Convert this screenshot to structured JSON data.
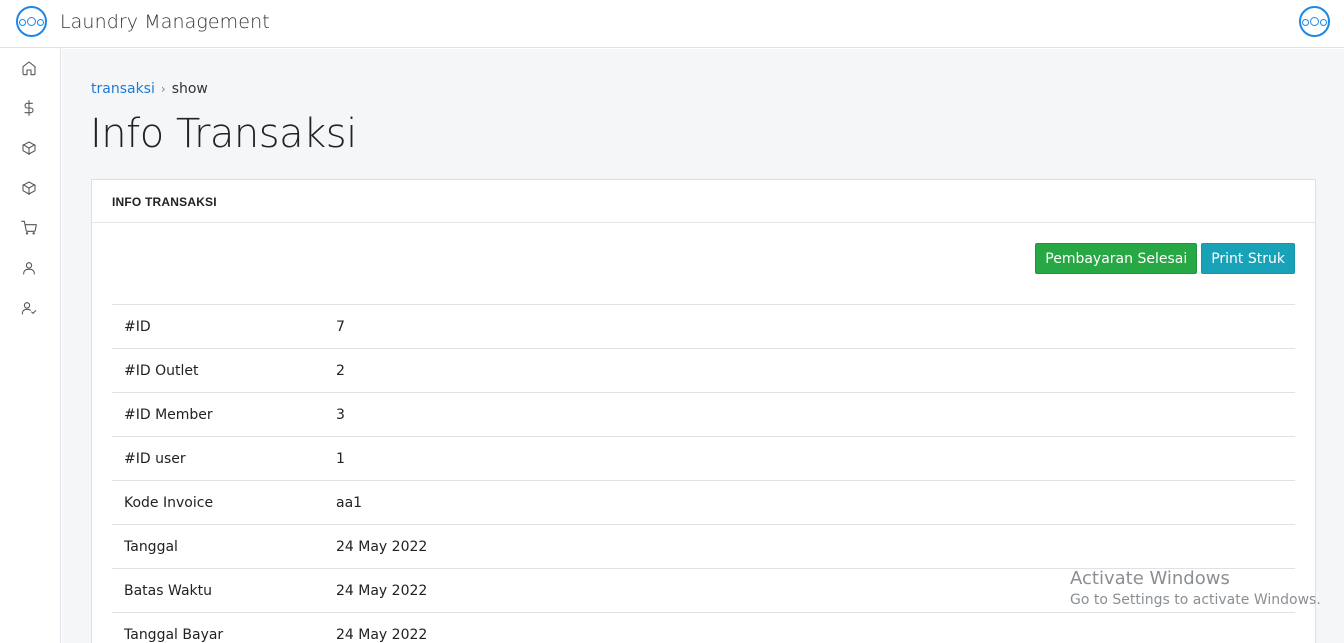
{
  "app": {
    "title": "Laundry Management"
  },
  "sidebar": {
    "items": [
      {
        "icon": "home-icon"
      },
      {
        "icon": "dollar-icon"
      },
      {
        "icon": "box-icon"
      },
      {
        "icon": "box-icon"
      },
      {
        "icon": "cart-icon"
      },
      {
        "icon": "user-icon"
      },
      {
        "icon": "user-check-icon"
      }
    ]
  },
  "breadcrumb": {
    "parent": "transaksi",
    "separator": "›",
    "current": "show"
  },
  "page": {
    "title": "Info Transaksi"
  },
  "card": {
    "header": "INFO TRANSAKSI",
    "buttons": {
      "pay": "Pembayaran Selesai",
      "print": "Print Struk"
    },
    "rows": [
      {
        "label": "#ID",
        "value": "7"
      },
      {
        "label": "#ID Outlet",
        "value": "2"
      },
      {
        "label": "#ID Member",
        "value": "3"
      },
      {
        "label": "#ID user",
        "value": "1"
      },
      {
        "label": "Kode Invoice",
        "value": "aa1"
      },
      {
        "label": "Tanggal",
        "value": "24 May 2022"
      },
      {
        "label": "Batas Waktu",
        "value": "24 May 2022"
      },
      {
        "label": "Tanggal Bayar",
        "value": "24 May 2022"
      }
    ]
  },
  "watermark": {
    "line1": "Activate Windows",
    "line2": "Go to Settings to activate Windows."
  },
  "colors": {
    "accent": "#1e88e5",
    "success": "#28a745",
    "info": "#17a2b8",
    "link": "#1e7bd6",
    "background": "#f4f6f8"
  }
}
